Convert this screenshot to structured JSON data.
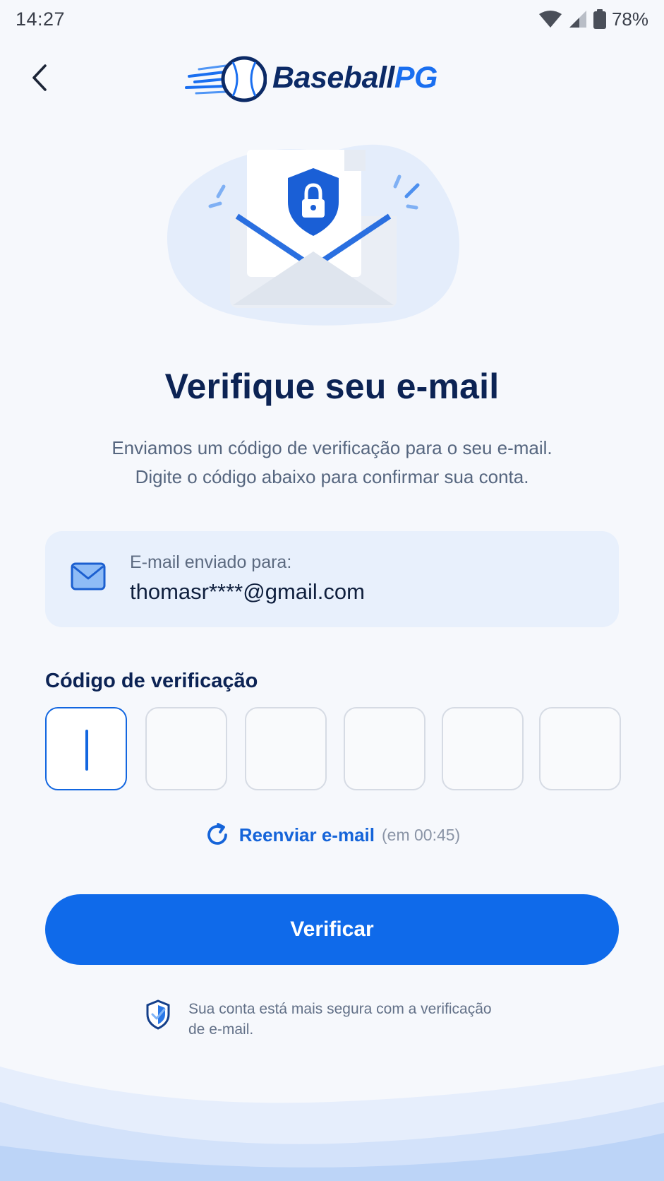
{
  "status_bar": {
    "time": "14:27",
    "battery": "78%",
    "icons": [
      "wifi-icon",
      "signal-icon",
      "battery-icon"
    ]
  },
  "header": {
    "back_icon": "chevron-left-icon",
    "logo_primary": "Baseball",
    "logo_accent": "PG"
  },
  "hero": {
    "illustration": "envelope-with-shield-lock"
  },
  "title": "Verifique seu e-mail",
  "subtitle": {
    "line1": "Enviamos um código de verificação para o seu e-mail.",
    "line2": "Digite o código abaixo para confirmar sua conta."
  },
  "email_card": {
    "label": "E-mail enviado para:",
    "email": "thomasr****@gmail.com",
    "icon": "mail-icon"
  },
  "code": {
    "label": "Código de verificação",
    "digits": [
      "",
      "",
      "",
      "",
      "",
      ""
    ]
  },
  "resend": {
    "label": "Reenviar e-mail",
    "timer": "(em 00:45)",
    "icon": "refresh-icon"
  },
  "verify_button": "Verificar",
  "security_note": {
    "line1": "Sua conta está mais segura com a verificação",
    "line2": "de e-mail.",
    "icon": "shield-check-icon"
  },
  "colors": {
    "primary": "#0f6aea",
    "heading": "#0c2354",
    "card_bg": "#e8f0fc",
    "background": "#f6f8fc"
  }
}
